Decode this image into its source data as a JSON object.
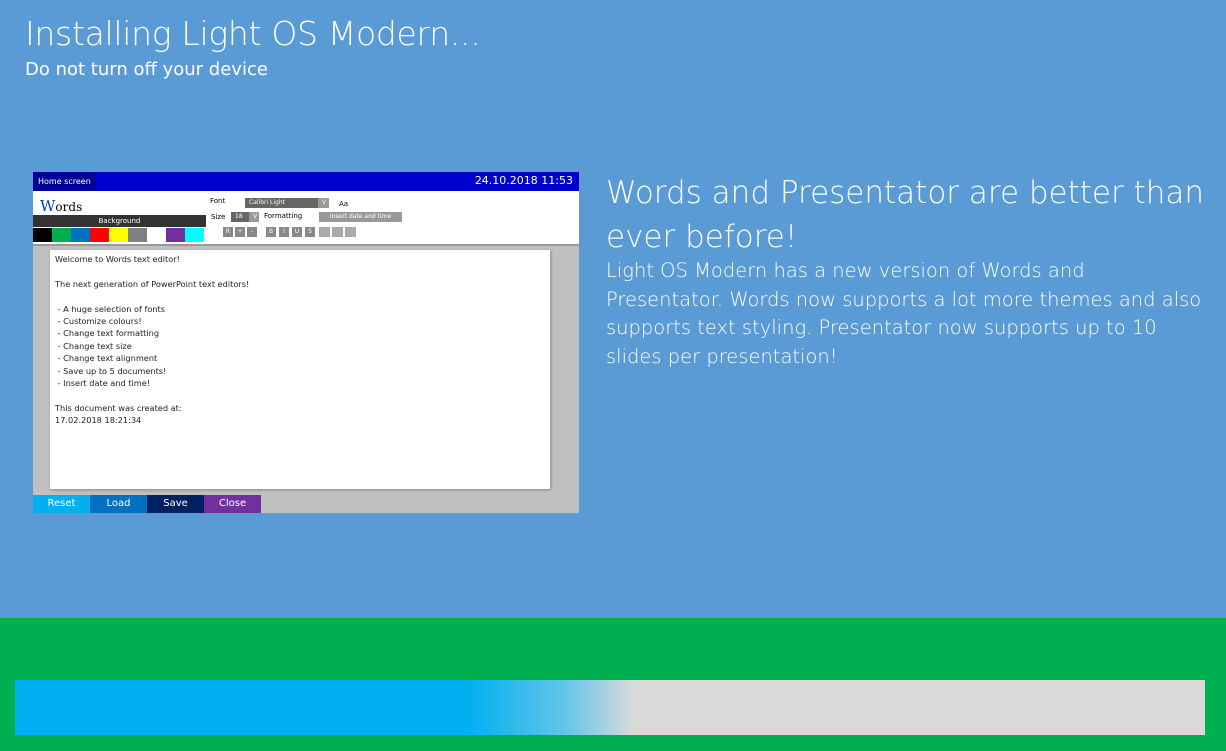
{
  "header": {
    "title": "Installing Light OS Modern...",
    "subtitle": "Do not turn off your device"
  },
  "preview": {
    "home_label": "Home screen",
    "clock": "24.10.2018 11:53",
    "logo_first": "W",
    "logo_rest": "ords",
    "background_label": "Background",
    "swatch_colors": [
      "#000000",
      "#00b050",
      "#0070c0",
      "#ff0000",
      "#ffff00",
      "#808080",
      "#ffffff",
      "#7030a0",
      "#00ffff"
    ],
    "font_label": "Font",
    "font_value": "Calibri Light",
    "font_dropdown": "V",
    "font_sample": "Aa",
    "size_label": "Size",
    "size_value": "18",
    "size_dropdown": "V",
    "formatting_label": "Formatting",
    "insert_date_label": "Insert date and time",
    "size_buttons": [
      "R",
      "+",
      "-"
    ],
    "style_buttons": [
      "B",
      "I",
      "U",
      "S"
    ],
    "document_lines": [
      "Welcome to Words text editor!",
      "",
      "The next generation of PowerPoint text editors!",
      "",
      " - A huge selection of fonts",
      " - Customize colours!",
      " - Change text formatting",
      " - Change text size",
      " - Change text alignment",
      " - Save up to 5 documents!",
      " - Insert date and time!",
      "",
      "This document was created at:",
      "17.02.2018 18:21:34"
    ],
    "buttons": [
      {
        "label": "Reset",
        "color": "#00b0f0"
      },
      {
        "label": "Load",
        "color": "#0070c0"
      },
      {
        "label": "Save",
        "color": "#002060"
      },
      {
        "label": "Close",
        "color": "#7030a0"
      }
    ]
  },
  "feature": {
    "headline": "Words and Presentator are better than ever before!",
    "description": "Light OS Modern has a new version of Words and Presentator. Words now supports a lot more themes and also supports text styling. Presentator now supports up to 10 slides per presentation!"
  },
  "progress": {
    "fraction": 0.43,
    "fill_color": "#00b0f0",
    "track_color": "#d9d9d9"
  },
  "colors": {
    "background": "#5b9bd5",
    "footer": "#00b050"
  }
}
